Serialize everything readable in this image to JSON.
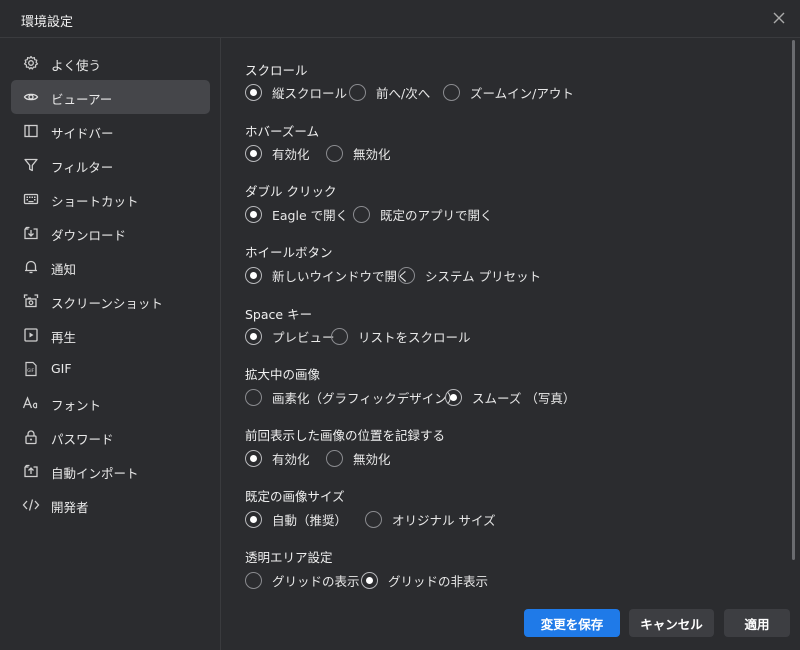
{
  "window": {
    "title": "環境設定"
  },
  "sidebar": {
    "items": [
      {
        "label": "よく使う",
        "icon": "gear-icon"
      },
      {
        "label": "ビューアー",
        "icon": "eye-icon",
        "active": true
      },
      {
        "label": "サイドバー",
        "icon": "sidebar-icon"
      },
      {
        "label": "フィルター",
        "icon": "filter-icon"
      },
      {
        "label": "ショートカット",
        "icon": "keyboard-icon"
      },
      {
        "label": "ダウンロード",
        "icon": "download-icon"
      },
      {
        "label": "通知",
        "icon": "bell-icon"
      },
      {
        "label": "スクリーンショット",
        "icon": "screenshot-icon"
      },
      {
        "label": "再生",
        "icon": "play-icon"
      },
      {
        "label": "GIF",
        "icon": "gif-icon"
      },
      {
        "label": "フォント",
        "icon": "font-icon"
      },
      {
        "label": "パスワード",
        "icon": "lock-icon"
      },
      {
        "label": "自動インポート",
        "icon": "import-icon"
      },
      {
        "label": "開発者",
        "icon": "code-icon"
      }
    ]
  },
  "sections": [
    {
      "title": "スクロール",
      "options": [
        {
          "label": "縦スクロール",
          "checked": true
        },
        {
          "label": "前へ/次へ",
          "checked": false
        },
        {
          "label": "ズームイン/アウト",
          "checked": false
        }
      ]
    },
    {
      "title": "ホバーズーム",
      "options": [
        {
          "label": "有効化",
          "checked": true
        },
        {
          "label": "無効化",
          "checked": false
        }
      ]
    },
    {
      "title": "ダブル クリック",
      "options": [
        {
          "label": "Eagle で開く",
          "checked": true
        },
        {
          "label": "既定のアプリで開く",
          "checked": false
        }
      ]
    },
    {
      "title": "ホイールボタン",
      "options": [
        {
          "label": "新しいウインドウで開く",
          "checked": true
        },
        {
          "label": "システム プリセット",
          "checked": false
        }
      ]
    },
    {
      "title": "Space キー",
      "options": [
        {
          "label": "プレビュー",
          "checked": true
        },
        {
          "label": "リストをスクロール",
          "checked": false
        }
      ]
    },
    {
      "title": "拡大中の画像",
      "options": [
        {
          "label": "画素化（グラフィックデザイン）",
          "checked": false
        },
        {
          "label": "スムーズ （写真）",
          "checked": true
        }
      ]
    },
    {
      "title": "前回表示した画像の位置を記録する",
      "options": [
        {
          "label": "有効化",
          "checked": true
        },
        {
          "label": "無効化",
          "checked": false
        }
      ]
    },
    {
      "title": "既定の画像サイズ",
      "options": [
        {
          "label": "自動（推奨）",
          "checked": true
        },
        {
          "label": "オリジナル サイズ",
          "checked": false
        }
      ]
    },
    {
      "title": "透明エリア設定",
      "options": [
        {
          "label": "グリッドの表示",
          "checked": false
        },
        {
          "label": "グリッドの非表示",
          "checked": true
        }
      ]
    }
  ],
  "footer": {
    "save_label": "変更を保存",
    "cancel_label": "キャンセル",
    "apply_label": "適用"
  },
  "colors": {
    "accent": "#1f7ae8",
    "background": "#2b2c2f",
    "active_nav": "#45464a"
  }
}
